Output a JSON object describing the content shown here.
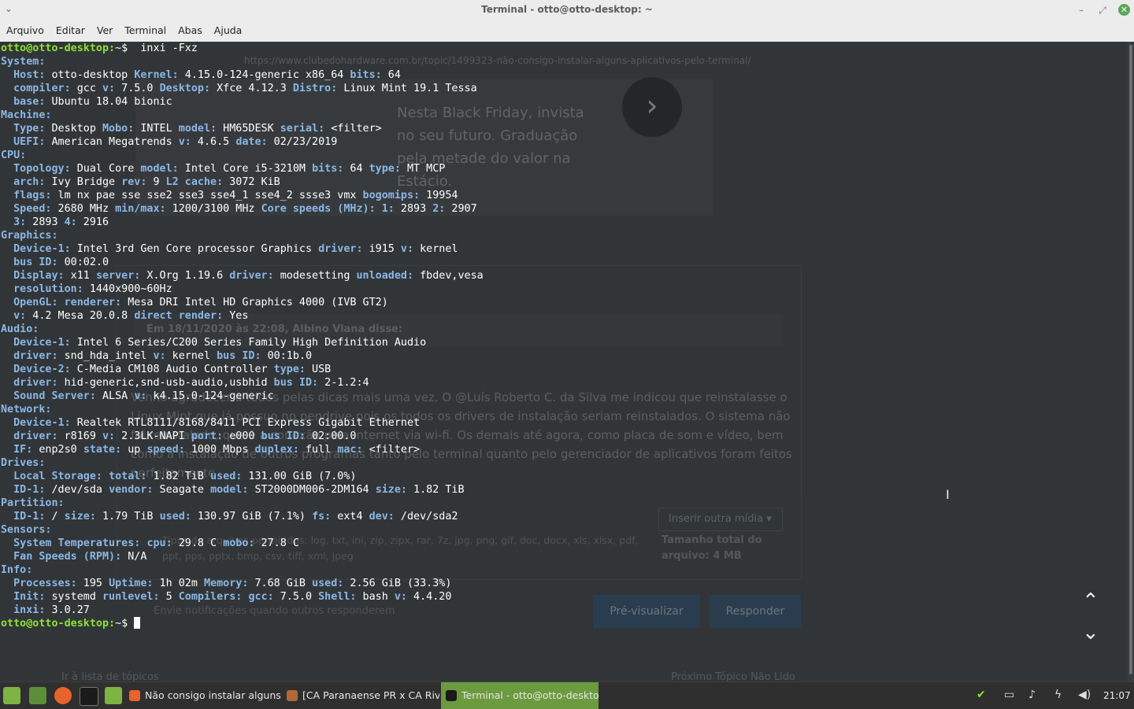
{
  "window": {
    "title": "Terminal - otto@otto-desktop: ~"
  },
  "menu": [
    "Arquivo",
    "Editar",
    "Ver",
    "Terminal",
    "Abas",
    "Ajuda"
  ],
  "terminal": {
    "lines": [
      [
        [
          "p",
          "otto@otto-desktop:"
        ],
        [
          "t",
          "~$  inxi -Fxz"
        ]
      ],
      [
        [
          "k",
          "System:"
        ]
      ],
      [
        [
          "t",
          "  "
        ],
        [
          "k",
          "Host:"
        ],
        [
          "t",
          " otto-desktop "
        ],
        [
          "k",
          "Kernel:"
        ],
        [
          "t",
          " 4.15.0-124-generic x86_64 "
        ],
        [
          "k",
          "bits:"
        ],
        [
          "t",
          " 64"
        ]
      ],
      [
        [
          "t",
          "  "
        ],
        [
          "k",
          "compiler:"
        ],
        [
          "t",
          " gcc "
        ],
        [
          "k",
          "v:"
        ],
        [
          "t",
          " 7.5.0 "
        ],
        [
          "k",
          "Desktop:"
        ],
        [
          "t",
          " Xfce 4.12.3 "
        ],
        [
          "k",
          "Distro:"
        ],
        [
          "t",
          " Linux Mint 19.1 Tessa"
        ]
      ],
      [
        [
          "t",
          "  "
        ],
        [
          "k",
          "base:"
        ],
        [
          "t",
          " Ubuntu 18.04 bionic"
        ]
      ],
      [
        [
          "k",
          "Machine:"
        ]
      ],
      [
        [
          "t",
          "  "
        ],
        [
          "k",
          "Type:"
        ],
        [
          "t",
          " Desktop "
        ],
        [
          "k",
          "Mobo:"
        ],
        [
          "t",
          " INTEL "
        ],
        [
          "k",
          "model:"
        ],
        [
          "t",
          " HM65DESK "
        ],
        [
          "k",
          "serial:"
        ],
        [
          "t",
          " <filter>"
        ]
      ],
      [
        [
          "t",
          "  "
        ],
        [
          "k",
          "UEFI:"
        ],
        [
          "t",
          " American Megatrends "
        ],
        [
          "k",
          "v:"
        ],
        [
          "t",
          " 4.6.5 "
        ],
        [
          "k",
          "date:"
        ],
        [
          "t",
          " 02/23/2019"
        ]
      ],
      [
        [
          "k",
          "CPU:"
        ]
      ],
      [
        [
          "t",
          "  "
        ],
        [
          "k",
          "Topology:"
        ],
        [
          "t",
          " Dual Core "
        ],
        [
          "k",
          "model:"
        ],
        [
          "t",
          " Intel Core i5-3210M "
        ],
        [
          "k",
          "bits:"
        ],
        [
          "t",
          " 64 "
        ],
        [
          "k",
          "type:"
        ],
        [
          "t",
          " MT MCP"
        ]
      ],
      [
        [
          "t",
          "  "
        ],
        [
          "k",
          "arch:"
        ],
        [
          "t",
          " Ivy Bridge "
        ],
        [
          "k",
          "rev:"
        ],
        [
          "t",
          " 9 "
        ],
        [
          "k",
          "L2 cache:"
        ],
        [
          "t",
          " 3072 KiB"
        ]
      ],
      [
        [
          "t",
          "  "
        ],
        [
          "k",
          "flags:"
        ],
        [
          "t",
          " lm nx pae sse sse2 sse3 sse4_1 sse4_2 ssse3 vmx "
        ],
        [
          "k",
          "bogomips:"
        ],
        [
          "t",
          " 19954"
        ]
      ],
      [
        [
          "t",
          "  "
        ],
        [
          "k",
          "Speed:"
        ],
        [
          "t",
          " 2680 MHz "
        ],
        [
          "k",
          "min/max:"
        ],
        [
          "t",
          " 1200/3100 MHz "
        ],
        [
          "k",
          "Core speeds (MHz):"
        ],
        [
          "t",
          " "
        ],
        [
          "k",
          "1:"
        ],
        [
          "t",
          " 2893 "
        ],
        [
          "k",
          "2:"
        ],
        [
          "t",
          " 2907"
        ]
      ],
      [
        [
          "t",
          "  "
        ],
        [
          "k",
          "3:"
        ],
        [
          "t",
          " 2893 "
        ],
        [
          "k",
          "4:"
        ],
        [
          "t",
          " 2916"
        ]
      ],
      [
        [
          "k",
          "Graphics:"
        ]
      ],
      [
        [
          "t",
          "  "
        ],
        [
          "k",
          "Device-1:"
        ],
        [
          "t",
          " Intel 3rd Gen Core processor Graphics "
        ],
        [
          "k",
          "driver:"
        ],
        [
          "t",
          " i915 "
        ],
        [
          "k",
          "v:"
        ],
        [
          "t",
          " kernel"
        ]
      ],
      [
        [
          "t",
          "  "
        ],
        [
          "k",
          "bus ID:"
        ],
        [
          "t",
          " 00:02.0"
        ]
      ],
      [
        [
          "t",
          "  "
        ],
        [
          "k",
          "Display:"
        ],
        [
          "t",
          " x11 "
        ],
        [
          "k",
          "server:"
        ],
        [
          "t",
          " X.Org 1.19.6 "
        ],
        [
          "k",
          "driver:"
        ],
        [
          "t",
          " modesetting "
        ],
        [
          "k",
          "unloaded:"
        ],
        [
          "t",
          " fbdev,vesa"
        ]
      ],
      [
        [
          "t",
          "  "
        ],
        [
          "k",
          "resolution:"
        ],
        [
          "t",
          " 1440x900~60Hz"
        ]
      ],
      [
        [
          "t",
          "  "
        ],
        [
          "k",
          "OpenGL:"
        ],
        [
          "t",
          " "
        ],
        [
          "k",
          "renderer:"
        ],
        [
          "t",
          " Mesa DRI Intel HD Graphics 4000 (IVB GT2)"
        ]
      ],
      [
        [
          "t",
          "  "
        ],
        [
          "k",
          "v:"
        ],
        [
          "t",
          " 4.2 Mesa 20.0.8 "
        ],
        [
          "k",
          "direct render:"
        ],
        [
          "t",
          " Yes"
        ]
      ],
      [
        [
          "k",
          "Audio:"
        ]
      ],
      [
        [
          "t",
          "  "
        ],
        [
          "k",
          "Device-1:"
        ],
        [
          "t",
          " Intel 6 Series/C200 Series Family High Definition Audio"
        ]
      ],
      [
        [
          "t",
          "  "
        ],
        [
          "k",
          "driver:"
        ],
        [
          "t",
          " snd_hda_intel "
        ],
        [
          "k",
          "v:"
        ],
        [
          "t",
          " kernel "
        ],
        [
          "k",
          "bus ID:"
        ],
        [
          "t",
          " 00:1b.0"
        ]
      ],
      [
        [
          "t",
          "  "
        ],
        [
          "k",
          "Device-2:"
        ],
        [
          "t",
          " C-Media CM108 Audio Controller "
        ],
        [
          "k",
          "type:"
        ],
        [
          "t",
          " USB"
        ]
      ],
      [
        [
          "t",
          "  "
        ],
        [
          "k",
          "driver:"
        ],
        [
          "t",
          " hid-generic,snd-usb-audio,usbhid "
        ],
        [
          "k",
          "bus ID:"
        ],
        [
          "t",
          " 2-1.2:4"
        ]
      ],
      [
        [
          "t",
          "  "
        ],
        [
          "k",
          "Sound Server:"
        ],
        [
          "t",
          " ALSA "
        ],
        [
          "k",
          "v:"
        ],
        [
          "t",
          " k4.15.0-124-generic"
        ]
      ],
      [
        [
          "k",
          "Network:"
        ]
      ],
      [
        [
          "t",
          "  "
        ],
        [
          "k",
          "Device-1:"
        ],
        [
          "t",
          " Realtek RTL8111/8168/8411 PCI Express Gigabit Ethernet"
        ]
      ],
      [
        [
          "t",
          "  "
        ],
        [
          "k",
          "driver:"
        ],
        [
          "t",
          " r8169 "
        ],
        [
          "k",
          "v:"
        ],
        [
          "t",
          " 2.3LK-NAPI "
        ],
        [
          "k",
          "port:"
        ],
        [
          "t",
          " e000 "
        ],
        [
          "k",
          "bus ID:"
        ],
        [
          "t",
          " 02:00.0"
        ]
      ],
      [
        [
          "t",
          "  "
        ],
        [
          "k",
          "IF:"
        ],
        [
          "t",
          " enp2s0 "
        ],
        [
          "k",
          "state:"
        ],
        [
          "t",
          " up "
        ],
        [
          "k",
          "speed:"
        ],
        [
          "t",
          " 1000 Mbps "
        ],
        [
          "k",
          "duplex:"
        ],
        [
          "t",
          " full "
        ],
        [
          "k",
          "mac:"
        ],
        [
          "t",
          " <filter>"
        ]
      ],
      [
        [
          "k",
          "Drives:"
        ]
      ],
      [
        [
          "t",
          "  "
        ],
        [
          "k",
          "Local Storage:"
        ],
        [
          "t",
          " "
        ],
        [
          "k",
          "total:"
        ],
        [
          "t",
          " 1.82 TiB "
        ],
        [
          "k",
          "used:"
        ],
        [
          "t",
          " 131.00 GiB (7.0%)"
        ]
      ],
      [
        [
          "t",
          "  "
        ],
        [
          "k",
          "ID-1:"
        ],
        [
          "t",
          " /dev/sda "
        ],
        [
          "k",
          "vendor:"
        ],
        [
          "t",
          " Seagate "
        ],
        [
          "k",
          "model:"
        ],
        [
          "t",
          " ST2000DM006-2DM164 "
        ],
        [
          "k",
          "size:"
        ],
        [
          "t",
          " 1.82 TiB"
        ]
      ],
      [
        [
          "k",
          "Partition:"
        ]
      ],
      [
        [
          "t",
          "  "
        ],
        [
          "k",
          "ID-1:"
        ],
        [
          "t",
          " / "
        ],
        [
          "k",
          "size:"
        ],
        [
          "t",
          " 1.79 TiB "
        ],
        [
          "k",
          "used:"
        ],
        [
          "t",
          " 130.97 GiB (7.1%) "
        ],
        [
          "k",
          "fs:"
        ],
        [
          "t",
          " ext4 "
        ],
        [
          "k",
          "dev:"
        ],
        [
          "t",
          " /dev/sda2"
        ]
      ],
      [
        [
          "k",
          "Sensors:"
        ]
      ],
      [
        [
          "t",
          "  "
        ],
        [
          "k",
          "System Temperatures:"
        ],
        [
          "t",
          " "
        ],
        [
          "k",
          "cpu:"
        ],
        [
          "t",
          " 29.8 C "
        ],
        [
          "k",
          "mobo:"
        ],
        [
          "t",
          " 27.8 C"
        ]
      ],
      [
        [
          "t",
          "  "
        ],
        [
          "k",
          "Fan Speeds (RPM):"
        ],
        [
          "t",
          " N/A"
        ]
      ],
      [
        [
          "k",
          "Info:"
        ]
      ],
      [
        [
          "t",
          "  "
        ],
        [
          "k",
          "Processes:"
        ],
        [
          "t",
          " 195 "
        ],
        [
          "k",
          "Uptime:"
        ],
        [
          "t",
          " 1h 02m "
        ],
        [
          "k",
          "Memory:"
        ],
        [
          "t",
          " 7.68 GiB "
        ],
        [
          "k",
          "used:"
        ],
        [
          "t",
          " 2.56 GiB (33.3%)"
        ]
      ],
      [
        [
          "t",
          "  "
        ],
        [
          "k",
          "Init:"
        ],
        [
          "t",
          " systemd "
        ],
        [
          "k",
          "runlevel:"
        ],
        [
          "t",
          " 5 "
        ],
        [
          "k",
          "Compilers:"
        ],
        [
          "t",
          " "
        ],
        [
          "k",
          "gcc:"
        ],
        [
          "t",
          " 7.5.0 "
        ],
        [
          "k",
          "Shell:"
        ],
        [
          "t",
          " bash "
        ],
        [
          "k",
          "v:"
        ],
        [
          "t",
          " 4.4.20"
        ]
      ],
      [
        [
          "t",
          "  "
        ],
        [
          "k",
          "inxi:"
        ],
        [
          "t",
          " 3.0.27"
        ]
      ],
      [
        [
          "p",
          "otto@otto-desktop:"
        ],
        [
          "t",
          "~$ "
        ],
        [
          "c",
          ""
        ]
      ]
    ]
  },
  "background_browser": {
    "url": "https://www.clubedohardware.com.br/topic/1499323-não-consigo-instalar-alguns-aplicativos-pelo-terminal/",
    "ad_text": "Nesta Black Friday, invista no seu futuro. Graduação pela metade do valor na Estácio.",
    "quote_header": "Em 18/11/2020 às 22:08, Albino Viana disse:",
    "body_text": "Venho agradecer a todos pelas dicas mais uma vez. O @Luís Roberto C. da Silva me indicou que reinstalasse o Linux Mint que já possuo no pendrive pois os todos os drivers de instalação seriam reinstalados. O sistema não foi reinstalado, que é a conexão pela internet via wi-fi. Os demais até agora, como placa de som e vídeo, bem como a instalação de outros programas tanto pelo terminal quanto pelo gerenciador de aplicativos foram feitos perfeitamente",
    "insert_media": "Inserir outra mídia ▾",
    "allowed_types": "Tipos de arquivos permitidos: log, txt, ini, zip, zipx, rar, 7z, jpg, png, gif, doc, docx, xls, xlsx, pdf, ppt, pps, pptx, bmp, csv, tiff, xml, jpeg",
    "total_size": "Tamanho total do arquivo: 4 MB",
    "notify": "Envie notificações quando outros responderem",
    "preview_button": "Pré-visualizar",
    "reply_button": "Responder",
    "prev_link": "Ir à lista de tópicos",
    "next_link": "Próximo Tópico Não Lido"
  },
  "taskbar": {
    "tasks": [
      {
        "label": "Não consigo instalar alguns ...",
        "icon": "firefox-icon"
      },
      {
        "label": "[CA Paranaense PR x CA Riv...",
        "icon": "media-icon"
      },
      {
        "label": "Terminal - otto@otto-deskto...",
        "icon": "terminal-icon"
      }
    ],
    "clock": "21:07"
  },
  "colors": {
    "terminal_bg": "#323537",
    "keyword": "#8ab7e7",
    "prompt": "#8ae234",
    "active_task": "#6c9b3f"
  }
}
